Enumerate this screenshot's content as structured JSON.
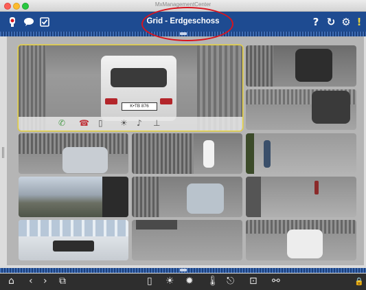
{
  "window": {
    "title": "MxManagementCenter"
  },
  "header": {
    "title": "Grid - Erdgeschoss"
  },
  "icons": {
    "header_left": [
      "camera-alarm-icon",
      "chat-icon",
      "checkbox-icon"
    ],
    "header_right": [
      "help-icon",
      "refresh-icon",
      "settings-icon",
      "alert-icon"
    ],
    "camera_controls": [
      "phone-accept-icon",
      "phone-hangup-icon",
      "door-icon",
      "light-icon",
      "sound-icon",
      "thermometer-icon"
    ],
    "footer": [
      "home-icon",
      "back-icon",
      "forward-icon",
      "layout-icon",
      "door-icon",
      "light-dim-icon",
      "light-bright-icon",
      "thermometer-icon",
      "ticket-icon",
      "snapshot-icon",
      "link-icon",
      "lock-icon"
    ]
  },
  "header_glyphs": {
    "help": "?",
    "refresh": "↻",
    "settings": "⚙",
    "alert": "!"
  },
  "footer_glyphs": {
    "home": "⌂",
    "back": "‹",
    "forward": "›",
    "layout": "⧉",
    "door": "▯",
    "light_dim": "☀",
    "light_bright": "✹",
    "thermo": "🌡",
    "ticket": "⎋",
    "snapshot": "⊡",
    "link": "⚯",
    "lock": "🔒"
  },
  "cameras": [
    {
      "name": "cam-parking-entrance",
      "plate": "K•TB 876",
      "selected": true
    },
    {
      "name": "cam-parking-dark-car"
    },
    {
      "name": "cam-parking-rear-car"
    },
    {
      "name": "cam-cyclist"
    },
    {
      "name": "cam-gate-car"
    },
    {
      "name": "cam-scooter"
    },
    {
      "name": "cam-field-panorama"
    },
    {
      "name": "cam-street-car"
    },
    {
      "name": "cam-sidewalk-walker"
    },
    {
      "name": "cam-lobby"
    },
    {
      "name": "cam-van"
    },
    {
      "name": "cam-white-car"
    }
  ],
  "colors": {
    "header": "#1e4b91",
    "selection": "#e8d23a",
    "annotation": "#d8141e"
  }
}
